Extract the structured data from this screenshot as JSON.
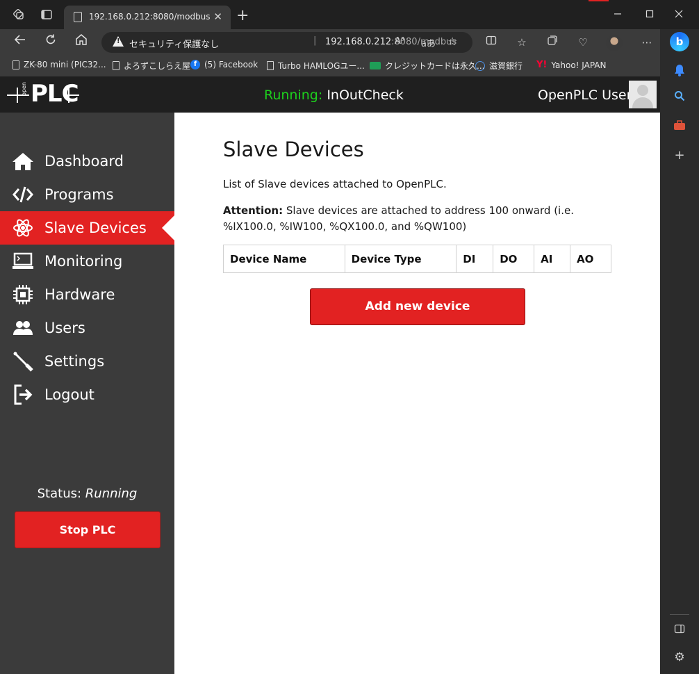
{
  "browser": {
    "tab_title": "192.168.0.212:8080/modbus",
    "tab_close": "✕",
    "new_tab": "+",
    "security_label": "セキュリティ保護なし",
    "url_host": "192.168.0.212",
    "url_rest": ":8080/modbus",
    "read_aloud": "A³",
    "translate": "aあ",
    "bookmarks": [
      {
        "label": "ZK-80 mini (PIC32...",
        "icon": "page-icon"
      },
      {
        "label": "よろずこしらえ屋",
        "icon": "page-icon"
      },
      {
        "label": "(5) Facebook",
        "icon": "facebook-icon"
      },
      {
        "label": "Turbo HAMLOGユー...",
        "icon": "page-icon"
      },
      {
        "label": "クレジットカードは永久...",
        "icon": "card-icon"
      },
      {
        "label": "滋賀銀行",
        "icon": "globe-icon"
      },
      {
        "label": "Yahoo! JAPAN",
        "icon": "yahoo-icon"
      }
    ],
    "yahoo_mark": "Y!",
    "bing_label": "b"
  },
  "header": {
    "status_prefix": "Running:",
    "program_name": "InOutCheck",
    "user_name": "OpenPLC User",
    "logo_text": "PLC",
    "logo_small": "open"
  },
  "sidebar": {
    "items": [
      {
        "label": "Dashboard",
        "icon": "home-icon"
      },
      {
        "label": "Programs",
        "icon": "code-icon"
      },
      {
        "label": "Slave Devices",
        "icon": "atom-icon"
      },
      {
        "label": "Monitoring",
        "icon": "monitor-icon"
      },
      {
        "label": "Hardware",
        "icon": "chip-icon"
      },
      {
        "label": "Users",
        "icon": "users-icon"
      },
      {
        "label": "Settings",
        "icon": "wrench-icon"
      },
      {
        "label": "Logout",
        "icon": "logout-icon"
      }
    ],
    "active_item": "Slave Devices",
    "status_label": "Status:",
    "status_value": "Running",
    "stop_button": "Stop PLC"
  },
  "main": {
    "title": "Slave Devices",
    "description": "List of Slave devices attached to OpenPLC.",
    "attention_label": "Attention:",
    "attention_text": " Slave devices are attached to address 100 onward (i.e. %IX100.0, %IW100, %QX100.0, and %QW100)",
    "table_headers": [
      "Device Name",
      "Device Type",
      "DI",
      "DO",
      "AI",
      "AO"
    ],
    "add_button": "Add new device"
  },
  "colors": {
    "accent_red": "#e22222",
    "running_green": "#1dd11d",
    "sidebar_bg": "#3b3b3b",
    "header_bg": "#1f1f1f"
  }
}
